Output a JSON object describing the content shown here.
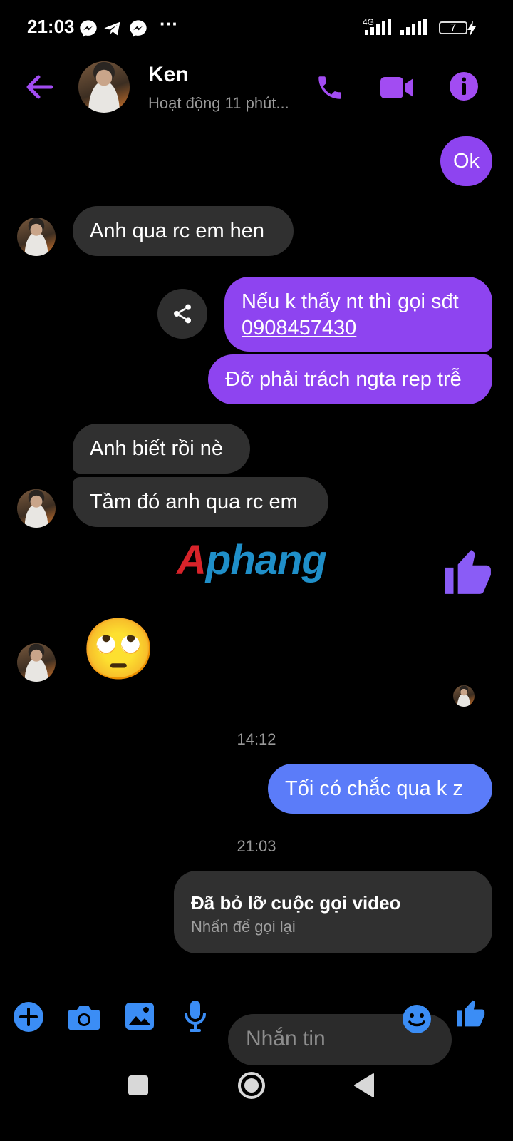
{
  "status_bar": {
    "time": "21:03",
    "dots": "···",
    "network": "4G",
    "battery": "7",
    "left_icons": [
      "messenger-icon",
      "telegram-icon",
      "messenger-icon"
    ]
  },
  "header": {
    "name": "Ken",
    "status": "Hoạt động 11 phút..."
  },
  "messages": {
    "m1": "Ok",
    "m2": "Anh qua rc em hen",
    "m3_line1": "Nếu k thấy nt thì gọi sđt",
    "m3_phone": "0908457430",
    "m4": "Đỡ phải trách ngta rep trễ",
    "m5": "Anh biết rồi nè",
    "m6": "Tầm đó anh qua rc em",
    "watermark": "Aphang",
    "emoji": "🙄",
    "time1": "14:12",
    "m7": "Tối có chắc qua k z",
    "time2": "21:03",
    "missed_call_title": "Đã bỏ lỡ cuộc gọi video",
    "missed_call_sub": "Nhấn để gọi lại"
  },
  "composer": {
    "placeholder": "Nhắn tin"
  },
  "colors": {
    "accent_purple": "#a24cf2",
    "outgoing_purple": "#8e44f0",
    "outgoing_blue": "#5b7cf9",
    "incoming_gray": "#303030",
    "composer_blue": "#3b8df5"
  }
}
